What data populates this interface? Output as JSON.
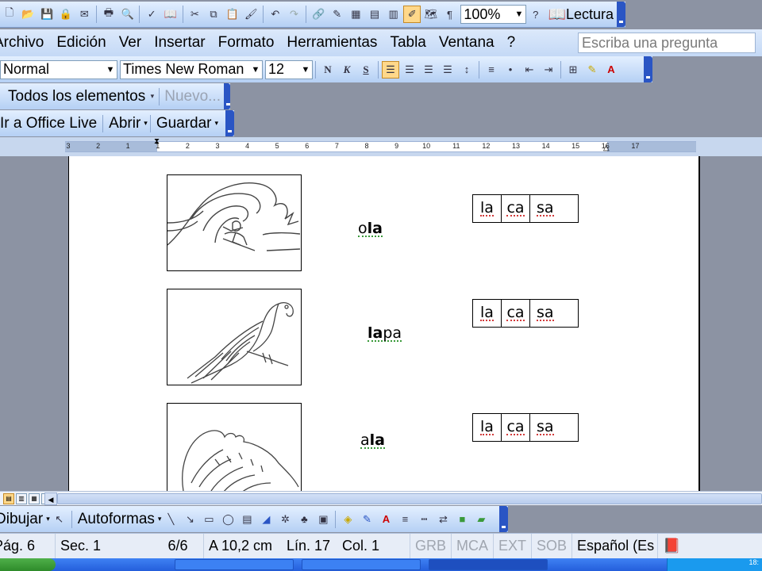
{
  "std_toolbar": {
    "zoom": "100%",
    "reading_label": "Lectura"
  },
  "menu": [
    "Archivo",
    "Edición",
    "Ver",
    "Insertar",
    "Formato",
    "Herramientas",
    "Tabla",
    "Ventana",
    "?"
  ],
  "ask_placeholder": "Escriba una pregunta",
  "format_toolbar": {
    "style": "Normal",
    "font": "Times New Roman",
    "size": "12",
    "bold": "N",
    "italic": "K",
    "underline": "S"
  },
  "web_toolbar": {
    "all_items": "Todos los elementos",
    "new": "Nuevo..."
  },
  "live_toolbar": {
    "go": "Ir a Office Live",
    "open": "Abrir",
    "save": "Guardar"
  },
  "ruler": [
    "3",
    "2",
    "1",
    "1",
    "2",
    "3",
    "4",
    "5",
    "6",
    "7",
    "8",
    "9",
    "10",
    "11",
    "12",
    "13",
    "14",
    "15",
    "16",
    "17"
  ],
  "rows": [
    {
      "word_pre": "o",
      "word_bold": "la",
      "word_post": "",
      "syllables": [
        "la",
        "ca",
        "sa"
      ]
    },
    {
      "word_pre": "",
      "word_bold": "la",
      "word_post": "pa",
      "syllables": [
        "la",
        "ca",
        "sa"
      ]
    },
    {
      "word_pre": "a",
      "word_bold": "la",
      "word_post": "",
      "syllables": [
        "la",
        "ca",
        "sa"
      ]
    }
  ],
  "draw_toolbar": {
    "draw": "Dibujar",
    "autoshapes": "Autoformas"
  },
  "status": {
    "page": "Pág. 6",
    "section": "Sec. 1",
    "pages": "6/6",
    "at": "A 10,2 cm",
    "line": "Lín. 17",
    "col": "Col. 1",
    "rec": "GRB",
    "trk": "MCA",
    "ext": "EXT",
    "ovr": "SOB",
    "lang": "Español (Es"
  },
  "tray_time": "18:"
}
